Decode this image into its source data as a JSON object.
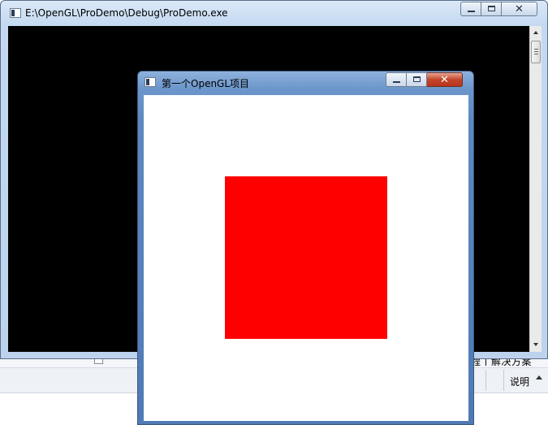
{
  "console_window": {
    "title": "E:\\OpenGL\\ProDemo\\Debug\\ProDemo.exe"
  },
  "opengl_window": {
    "title": "第一个OpenGL项目",
    "background_color": "#ffffff",
    "square_color": "#ff0000"
  },
  "ide_background": {
    "partial_text": "程丨解决方案",
    "column_label": "说明"
  }
}
